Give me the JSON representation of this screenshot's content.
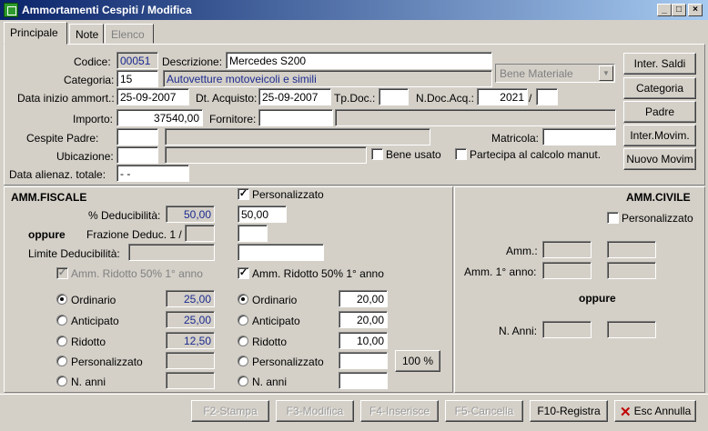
{
  "window": {
    "title": "Ammortamenti Cespiti / Modifica",
    "minimize": "_",
    "maximize": "□",
    "close": "×"
  },
  "tabs": [
    {
      "label": "Principale",
      "state": "active"
    },
    {
      "label": "Note",
      "state": "normal"
    },
    {
      "label": "Elenco",
      "state": "disabled"
    }
  ],
  "main": {
    "codice_label": "Codice:",
    "codice": "00051",
    "descrizione_label": "Descrizione:",
    "descrizione": "Mercedes S200",
    "categoria_label": "Categoria:",
    "categoria": "15",
    "categoria_desc": "Autovetture motoveicoli e simili",
    "bene_combo": "Bene Materiale",
    "data_inizio_label": "Data inizio ammort.:",
    "data_inizio": "25-09-2007",
    "dt_acquisto_label": "Dt. Acquisto:",
    "dt_acquisto": "25-09-2007",
    "tpdoc_label": "Tp.Doc.:",
    "tpdoc": "",
    "ndoc_label": "N.Doc.Acq.:",
    "ndoc_year": "2021",
    "ndoc_sep": "/",
    "ndoc_num": "",
    "importo_label": "Importo:",
    "importo": "37540,00",
    "fornitore_label": "Fornitore:",
    "fornitore": "",
    "cespite_padre_label": "Cespite Padre:",
    "matricola_label": "Matricola:",
    "ubicazione_label": "Ubicazione:",
    "bene_usato_label": "Bene usato",
    "partecipa_label": "Partecipa al calcolo manut.",
    "data_alien_label": "Data alienaz. totale:",
    "data_alien": "- -"
  },
  "side_buttons": {
    "inter_saldi": "Inter. Saldi",
    "categoria": "Categoria",
    "padre": "Padre",
    "inter_movim": "Inter.Movim.",
    "nuovo_movim": "Nuovo Movim"
  },
  "fiscale": {
    "title": "AMM.FISCALE",
    "personalizzato_label": "Personalizzato",
    "deducibilita_label": "% Deducibilità:",
    "deducibilita_std": "50,00",
    "deducibilita_pers": "50,00",
    "oppure": "oppure",
    "frazione_label": "Frazione Deduc. 1 /",
    "limite_label": "Limite Deducibilità:",
    "amm_ridotto_label": "Amm. Ridotto  50% 1° anno",
    "ordinario_label": "Ordinario",
    "anticipato_label": "Anticipato",
    "ridotto_label": "Ridotto",
    "personalizzato2_label": "Personalizzato",
    "n_anni_label": "N. anni",
    "std_ordinario": "25,00",
    "std_anticipato": "25,00",
    "std_ridotto": "12,50",
    "pers_ordinario": "20,00",
    "pers_anticipato": "20,00",
    "pers_ridotto": "10,00",
    "btn_100": "100 %"
  },
  "civile": {
    "title": "AMM.CIVILE",
    "personalizzato_label": "Personalizzato",
    "amm_label": "Amm.:",
    "amm1_label": "Amm. 1° anno:",
    "oppure": "oppure",
    "nanni_label": "N. Anni:"
  },
  "footer": {
    "f2": "F2-Stampa",
    "f3": "F3-Modifica",
    "f4": "F4-Inserisce",
    "f5": "F5-Cancella",
    "f10": "F10-Registra",
    "esc": "Esc Annulla"
  }
}
